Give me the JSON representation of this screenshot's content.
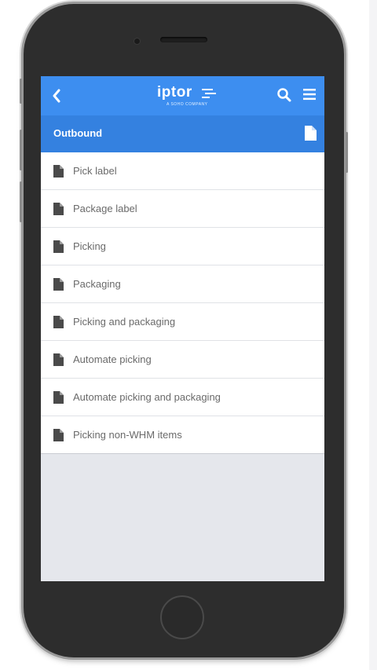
{
  "header": {
    "back_icon": "chevron-left-icon",
    "logo_text": "iptor",
    "logo_subtext": "A SOHO COMPANY",
    "search_icon": "search-icon",
    "menu_icon": "hamburger-menu-icon",
    "color": "#3d8ef0"
  },
  "section": {
    "title": "Outbound",
    "icon": "document-icon",
    "color": "#3481e0"
  },
  "menu": {
    "items": [
      {
        "label": "Pick label",
        "icon": "document-icon"
      },
      {
        "label": "Package label",
        "icon": "document-icon"
      },
      {
        "label": "Picking",
        "icon": "document-icon"
      },
      {
        "label": "Packaging",
        "icon": "document-icon"
      },
      {
        "label": "Picking and packaging",
        "icon": "document-icon"
      },
      {
        "label": "Automate picking",
        "icon": "document-icon"
      },
      {
        "label": "Automate picking and packaging",
        "icon": "document-icon"
      },
      {
        "label": "Picking non-WHM items",
        "icon": "document-icon"
      }
    ]
  }
}
